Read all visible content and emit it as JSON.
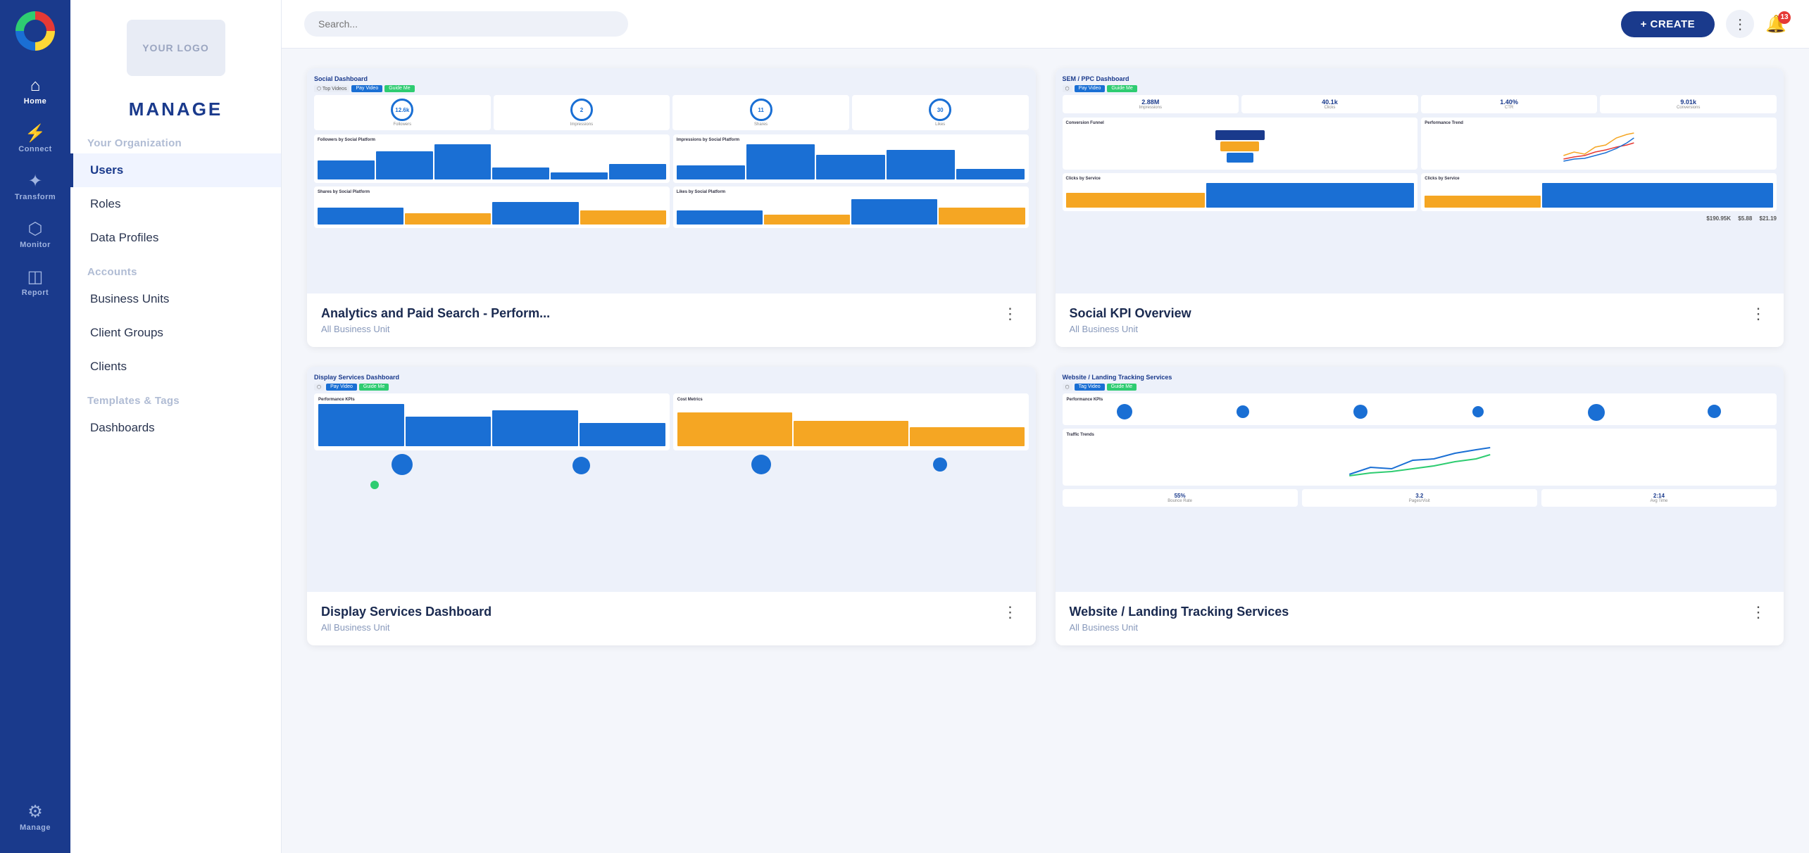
{
  "app": {
    "title": "Manage",
    "logo_text": "YOUR LOGO"
  },
  "icon_nav": {
    "items": [
      {
        "id": "home",
        "icon": "⌂",
        "label": "Home"
      },
      {
        "id": "connect",
        "icon": "⚡",
        "label": "Connect"
      },
      {
        "id": "transform",
        "icon": "✦",
        "label": "Transform"
      },
      {
        "id": "monitor",
        "icon": "📈",
        "label": "Monitor"
      },
      {
        "id": "report",
        "icon": "🗒",
        "label": "Report"
      },
      {
        "id": "manage",
        "icon": "⚙",
        "label": "Manage"
      }
    ]
  },
  "sidebar": {
    "manage_title": "MANAGE",
    "sections": [
      {
        "header": "Your Organization",
        "items": [
          {
            "id": "users",
            "label": "Users",
            "active": true
          },
          {
            "id": "roles",
            "label": "Roles"
          },
          {
            "id": "data-profiles",
            "label": "Data Profiles"
          }
        ]
      },
      {
        "header": "Accounts",
        "items": [
          {
            "id": "business-units",
            "label": "Business Units"
          },
          {
            "id": "client-groups",
            "label": "Client Groups"
          },
          {
            "id": "clients",
            "label": "Clients"
          }
        ]
      },
      {
        "header": "Templates & Tags",
        "items": [
          {
            "id": "dashboards",
            "label": "Dashboards"
          }
        ]
      }
    ]
  },
  "topbar": {
    "search_placeholder": "Search...",
    "create_label": "+ CREATE",
    "notification_count": "13"
  },
  "dashboard_cards": [
    {
      "id": "card1",
      "title": "Analytics and Paid Search - Perform...",
      "subtitle": "All Business Unit",
      "preview_type": "social"
    },
    {
      "id": "card2",
      "title": "Social KPI Overview",
      "subtitle": "All Business Unit",
      "preview_type": "sem"
    },
    {
      "id": "card3",
      "title": "Display Services Dashboard",
      "subtitle": "All Business Unit",
      "preview_type": "display"
    },
    {
      "id": "card4",
      "title": "Website / Landing Tracking Services",
      "subtitle": "All Business Unit",
      "preview_type": "website"
    }
  ],
  "colors": {
    "primary": "#1a3a8c",
    "accent": "#e53935",
    "sidebar_bg": "#ffffff",
    "nav_bg": "#1a3a8c"
  }
}
